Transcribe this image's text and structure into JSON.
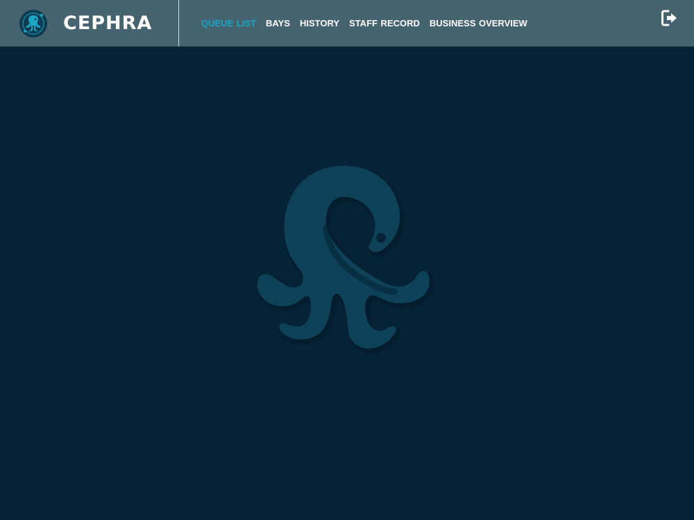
{
  "app": {
    "name": "CEPHRA"
  },
  "nav": {
    "items": [
      {
        "label": "QUEUE  LIST",
        "active": true
      },
      {
        "label": "BAYS",
        "active": false
      },
      {
        "label": "HISTORY",
        "active": false
      },
      {
        "label": "STAFF RECORD",
        "active": false
      },
      {
        "label": "BUSINESS OVERVIEW",
        "active": false
      }
    ]
  },
  "icons": {
    "brand_logo": "octopus-logo-icon",
    "logout": "logout-icon",
    "watermark": "octopus-watermark-icon"
  },
  "colors": {
    "topbar": "#466370",
    "background": "#062337",
    "accent": "#1ba6c6",
    "watermark": "#0b4258"
  }
}
